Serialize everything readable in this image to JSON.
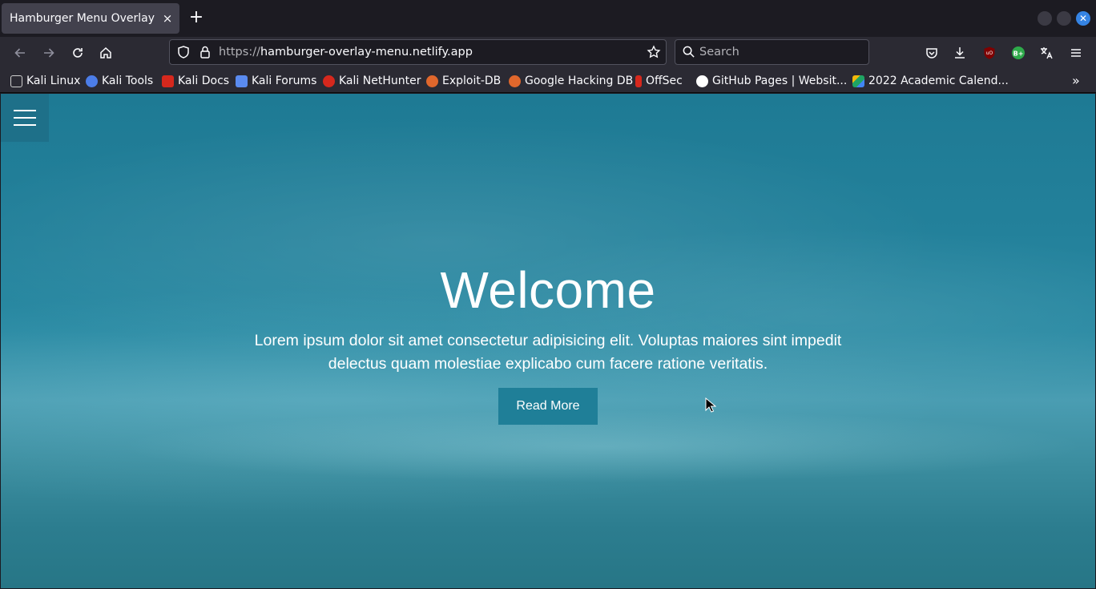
{
  "browser": {
    "tab": {
      "title": "Hamburger Menu Overlay",
      "close_icon": "×"
    },
    "new_tab_icon": "+",
    "url": {
      "scheme": "https://",
      "host": "hamburger-overlay-menu.netlify.app"
    },
    "search_placeholder": "Search",
    "bookmarks": [
      {
        "label": "Kali Linux",
        "icon_color": "#cfcfcf"
      },
      {
        "label": "Kali Tools",
        "icon_color": "#4c7de8"
      },
      {
        "label": "Kali Docs",
        "icon_color": "#d6281d"
      },
      {
        "label": "Kali Forums",
        "icon_color": "#5a8bf0"
      },
      {
        "label": "Kali NetHunter",
        "icon_color": "#d6281d"
      },
      {
        "label": "Exploit-DB",
        "icon_color": "#e0672c"
      },
      {
        "label": "Google Hacking DB",
        "icon_color": "#e0672c"
      },
      {
        "label": "OffSec",
        "icon_color": "#d6281d"
      },
      {
        "label": "GitHub Pages | Websit...",
        "icon_color": "#ffffff"
      },
      {
        "label": "2022 Academic Calend...",
        "icon_color": "#f2b80a"
      }
    ],
    "overflow_icon": "»"
  },
  "page": {
    "hero": {
      "title": "Welcome",
      "text": "Lorem ipsum dolor sit amet consectetur adipisicing elit. Voluptas maiores sint impedit delectus quam molestiae explicabo cum facere ratione veritatis.",
      "button_label": "Read More"
    }
  }
}
